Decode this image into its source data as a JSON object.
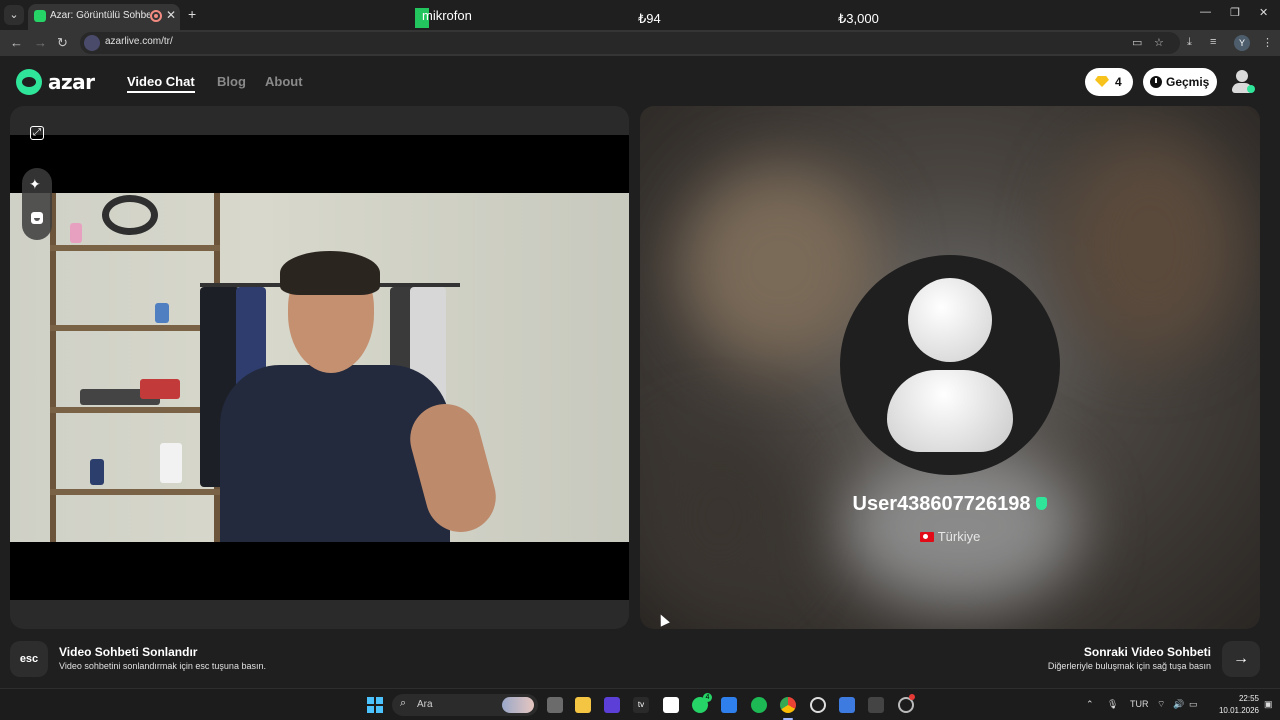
{
  "browser": {
    "tab_title": "Azar: Görüntülü Sohbet & Video Chat",
    "url": "azarlive.com/tr/",
    "profile_initial": "Y"
  },
  "overlay": {
    "mic_label": "mikrofon",
    "price_1": "₺94",
    "price_2": "₺3,000"
  },
  "header": {
    "logo_text": "azar",
    "nav": [
      {
        "label": "Video Chat",
        "active": true
      },
      {
        "label": "Blog",
        "active": false
      },
      {
        "label": "About",
        "active": false
      }
    ],
    "gem_count": "4",
    "history_label": "Geçmiş"
  },
  "peer": {
    "username": "User438607726198",
    "country": "Türkiye"
  },
  "footer": {
    "esc_key": "esc",
    "end_title": "Video Sohbeti Sonlandır",
    "end_sub": "Video sohbetini sonlandırmak için esc tuşuna basın.",
    "next_title": "Sonraki Video Sohbeti",
    "next_sub": "Diğerleriyle buluşmak için sağ tuşa basın"
  },
  "taskbar": {
    "search_label": "Ara",
    "whatsapp_badge": "4",
    "language": "TUR",
    "time": "22:55",
    "date": "10.01.2026"
  },
  "colors": {
    "brand_green": "#2fe59a",
    "gem_yellow": "#f7c21b",
    "page_bg": "#1f1f1f"
  },
  "icons": [
    "expand-icon",
    "sparkle-icon",
    "face-filter-icon",
    "gem-icon",
    "clock-icon",
    "verified-shield-icon",
    "turkey-flag-icon",
    "arrow-right-icon"
  ]
}
